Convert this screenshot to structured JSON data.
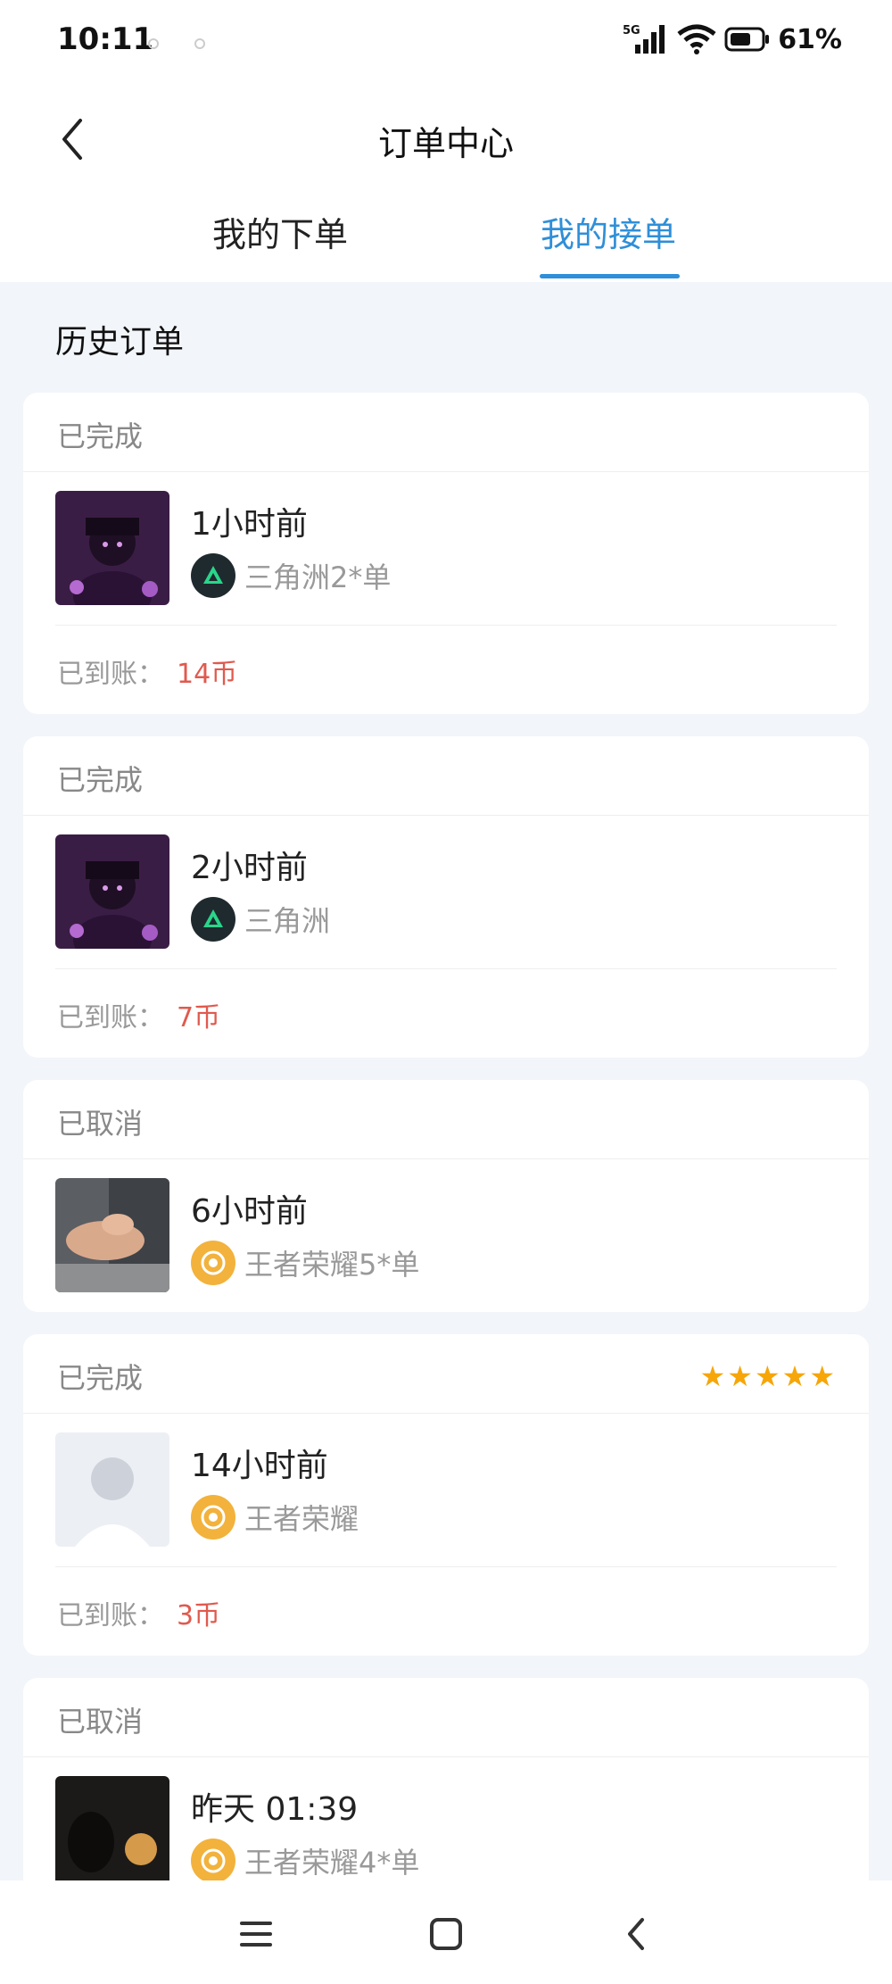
{
  "status_bar": {
    "time": "10:11",
    "network": "5G",
    "battery": "61%"
  },
  "header": {
    "title": "订单中心"
  },
  "tabs": [
    {
      "label": "我的下单",
      "active": false
    },
    {
      "label": "我的接单",
      "active": true
    }
  ],
  "section_title": "历史订单",
  "payout_label": "已到账：",
  "orders": [
    {
      "status": "已完成",
      "time": "1小时前",
      "game": "三角洲2*单",
      "game_icon": "delta-force-icon",
      "payout": "14币"
    },
    {
      "status": "已完成",
      "time": "2小时前",
      "game": "三角洲",
      "game_icon": "delta-force-icon",
      "payout": "7币"
    },
    {
      "status": "已取消",
      "time": "6小时前",
      "game": "王者荣耀5*单",
      "game_icon": "honor-of-kings-icon"
    },
    {
      "status": "已完成",
      "time": "14小时前",
      "game": "王者荣耀",
      "game_icon": "honor-of-kings-icon",
      "payout": "3币",
      "rating": 5,
      "stars": "★★★★★"
    },
    {
      "status": "已取消",
      "time": "昨天 01:39",
      "game": "王者荣耀4*单",
      "game_icon": "honor-of-kings-icon"
    }
  ],
  "colors": {
    "accent": "#2f8fd8",
    "amount": "#e05a4e",
    "star": "#f6a609"
  }
}
